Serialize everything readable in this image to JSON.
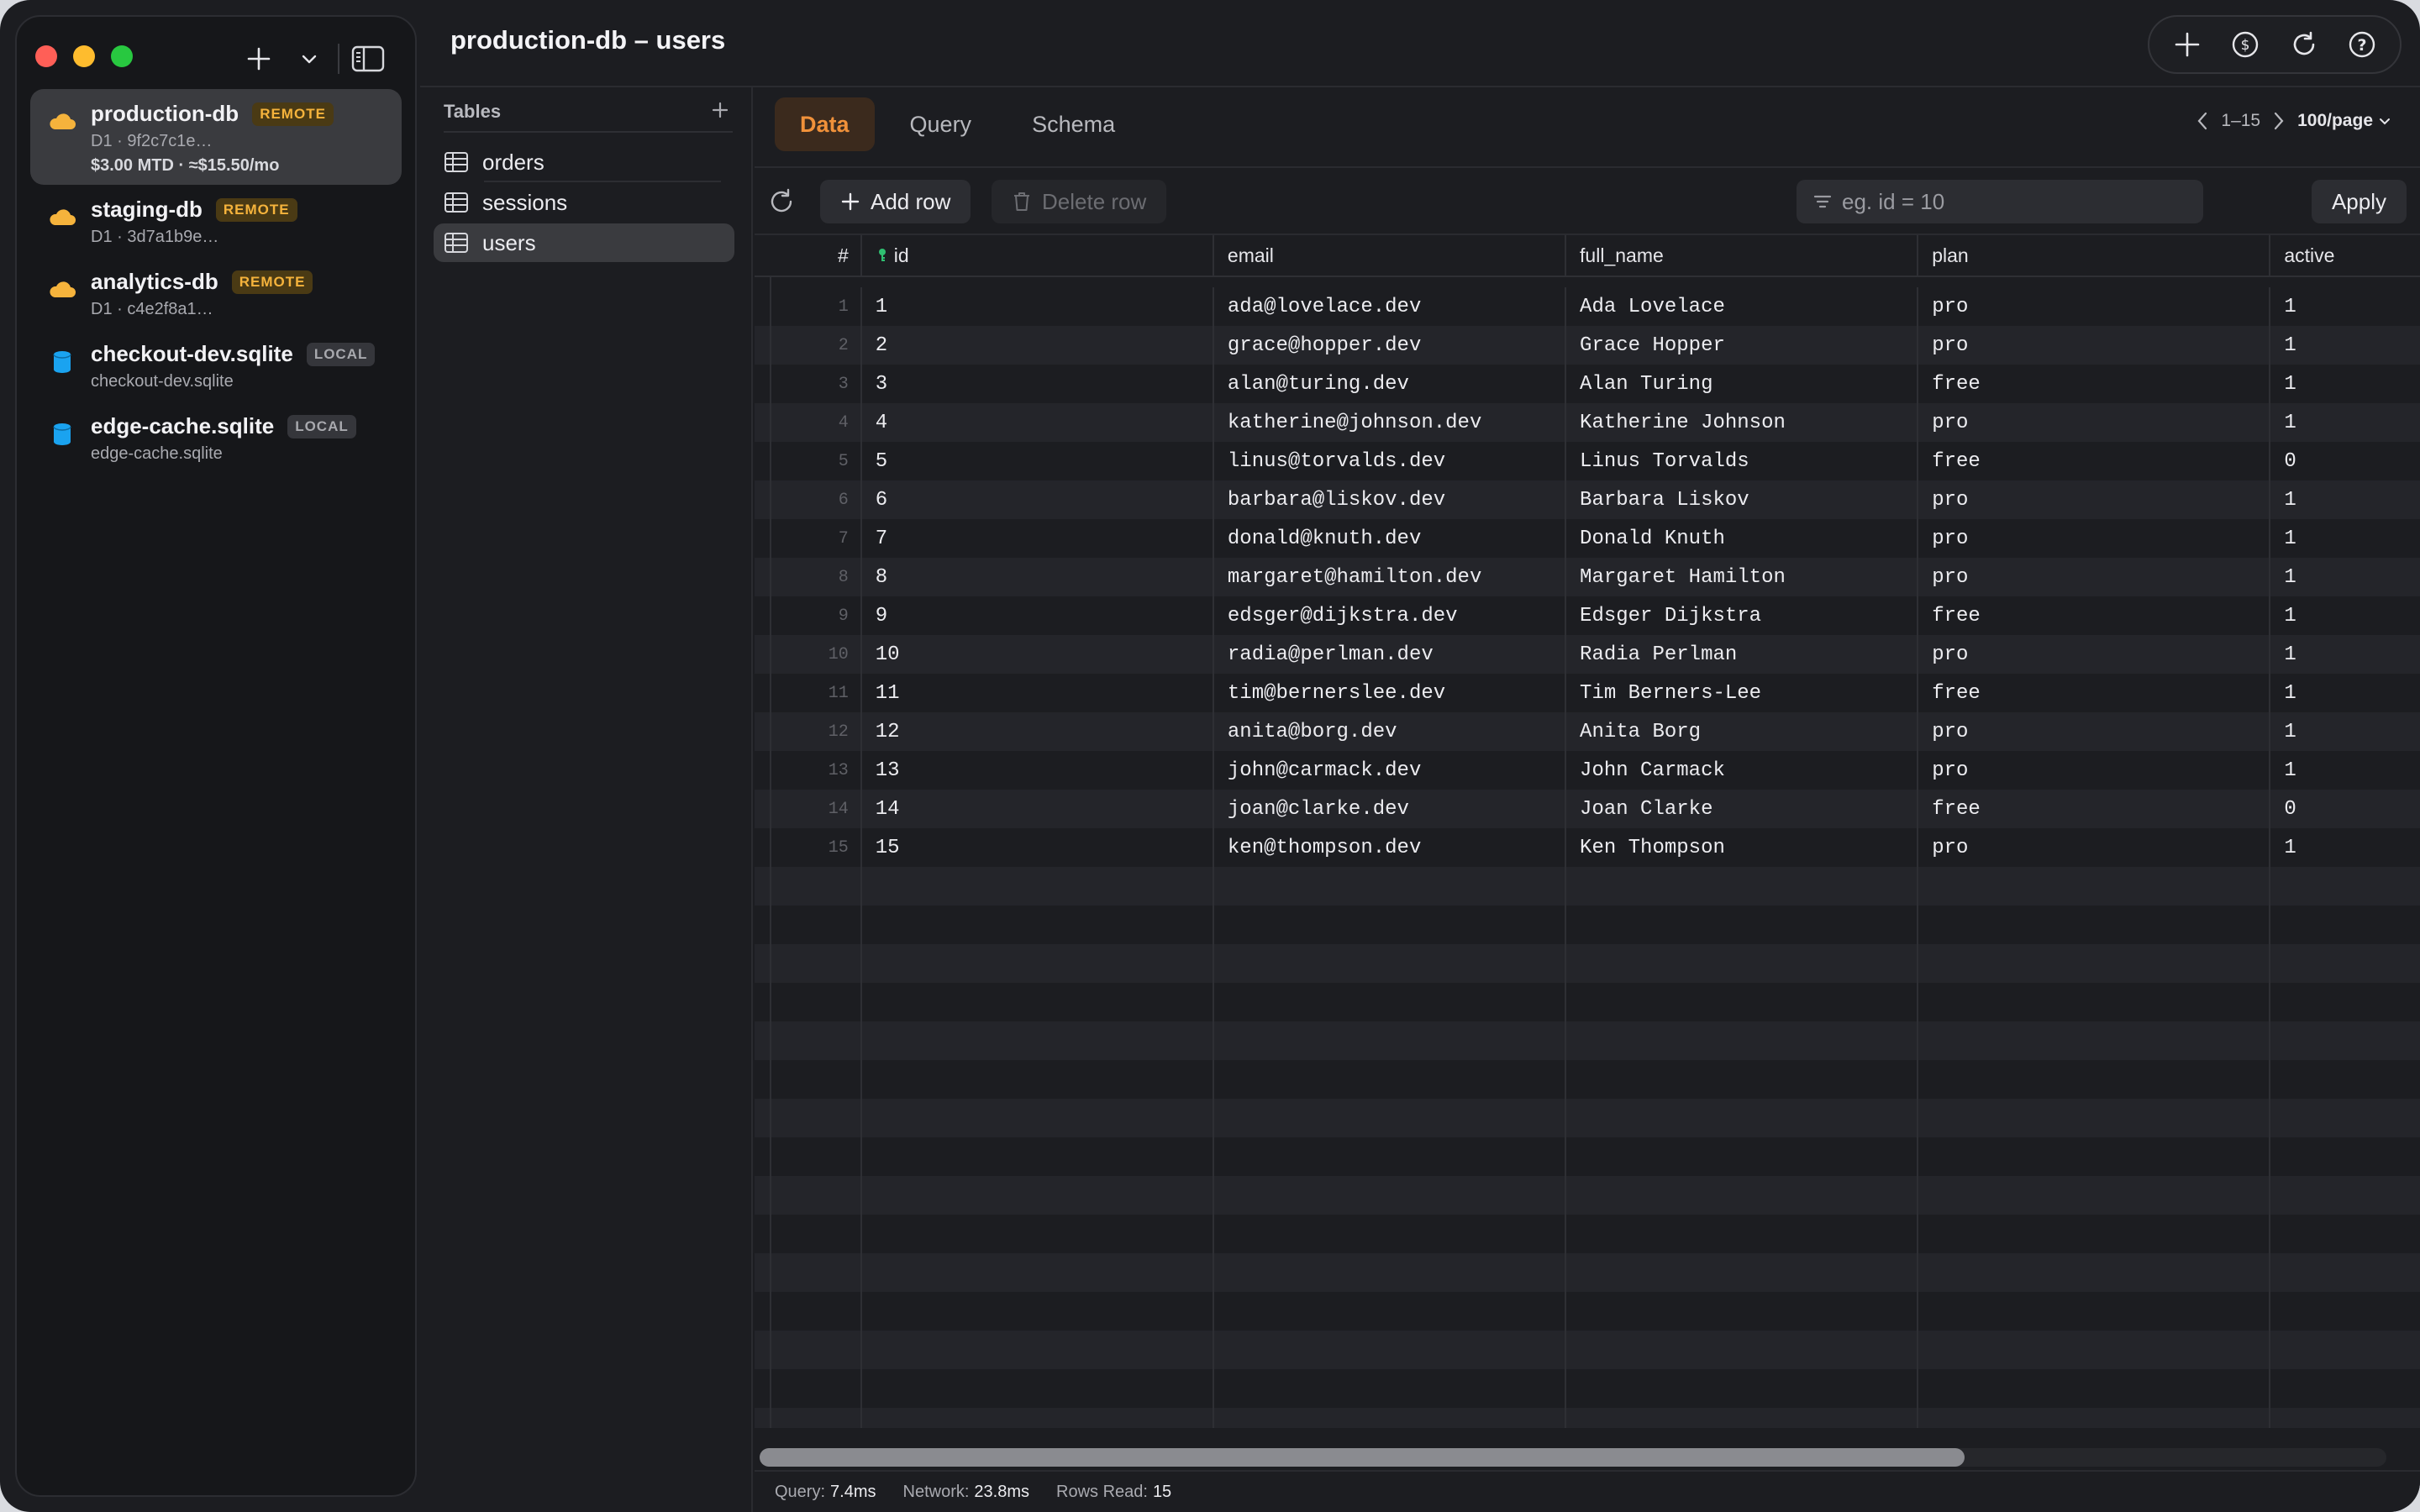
{
  "window": {
    "title": "production-db – users"
  },
  "sidebar": {
    "databases": [
      {
        "name": "production-db",
        "badge": "REMOTE",
        "badge_type": "remote",
        "sub": "D1 · 9f2c7c1e…",
        "cost": "$3.00 MTD · ≈$15.50/mo",
        "icon": "cloud-icon",
        "active": true
      },
      {
        "name": "staging-db",
        "badge": "REMOTE",
        "badge_type": "remote",
        "sub": "D1 · 3d7a1b9e…",
        "icon": "cloud-icon"
      },
      {
        "name": "analytics-db",
        "badge": "REMOTE",
        "badge_type": "remote",
        "sub": "D1 · c4e2f8a1…",
        "icon": "cloud-icon"
      },
      {
        "name": "checkout-dev.sqlite",
        "badge": "LOCAL",
        "badge_type": "local",
        "sub": "checkout-dev.sqlite",
        "icon": "database-icon"
      },
      {
        "name": "edge-cache.sqlite",
        "badge": "LOCAL",
        "badge_type": "local",
        "sub": "edge-cache.sqlite",
        "icon": "database-icon"
      }
    ]
  },
  "tables_pane": {
    "label": "Tables",
    "tables": [
      {
        "name": "orders"
      },
      {
        "name": "sessions"
      },
      {
        "name": "users",
        "active": true
      }
    ]
  },
  "tabs": [
    {
      "label": "Data",
      "active": true
    },
    {
      "label": "Query"
    },
    {
      "label": "Schema"
    }
  ],
  "pager": {
    "range": "1–15",
    "per_page": "100/page"
  },
  "toolbar": {
    "add_row": "Add row",
    "delete_row": "Delete row",
    "filter_placeholder": "eg. id = 10",
    "apply": "Apply"
  },
  "grid": {
    "columns": [
      "#",
      "id",
      "email",
      "full_name",
      "plan",
      "active"
    ],
    "rows": [
      [
        "1",
        "1",
        "ada@lovelace.dev",
        "Ada Lovelace",
        "pro",
        "1"
      ],
      [
        "2",
        "2",
        "grace@hopper.dev",
        "Grace Hopper",
        "pro",
        "1"
      ],
      [
        "3",
        "3",
        "alan@turing.dev",
        "Alan Turing",
        "free",
        "1"
      ],
      [
        "4",
        "4",
        "katherine@johnson.dev",
        "Katherine Johnson",
        "pro",
        "1"
      ],
      [
        "5",
        "5",
        "linus@torvalds.dev",
        "Linus Torvalds",
        "free",
        "0"
      ],
      [
        "6",
        "6",
        "barbara@liskov.dev",
        "Barbara Liskov",
        "pro",
        "1"
      ],
      [
        "7",
        "7",
        "donald@knuth.dev",
        "Donald Knuth",
        "pro",
        "1"
      ],
      [
        "8",
        "8",
        "margaret@hamilton.dev",
        "Margaret Hamilton",
        "pro",
        "1"
      ],
      [
        "9",
        "9",
        "edsger@dijkstra.dev",
        "Edsger Dijkstra",
        "free",
        "1"
      ],
      [
        "10",
        "10",
        "radia@perlman.dev",
        "Radia Perlman",
        "pro",
        "1"
      ],
      [
        "11",
        "11",
        "tim@bernerslee.dev",
        "Tim Berners-Lee",
        "free",
        "1"
      ],
      [
        "12",
        "12",
        "anita@borg.dev",
        "Anita Borg",
        "pro",
        "1"
      ],
      [
        "13",
        "13",
        "john@carmack.dev",
        "John Carmack",
        "pro",
        "1"
      ],
      [
        "14",
        "14",
        "joan@clarke.dev",
        "Joan Clarke",
        "free",
        "0"
      ],
      [
        "15",
        "15",
        "ken@thompson.dev",
        "Ken Thompson",
        "pro",
        "1"
      ]
    ]
  },
  "status": {
    "query_label": "Query:",
    "query_value": "7.4ms",
    "network_label": "Network:",
    "network_value": "23.8ms",
    "rows_label": "Rows Read:",
    "rows_value": "15"
  },
  "colors": {
    "accent": "#f0913a",
    "remote_badge": "#f5b33c",
    "cloud": "#f5b33c",
    "sqlite": "#1aa3f0",
    "key": "#2fbf71"
  }
}
